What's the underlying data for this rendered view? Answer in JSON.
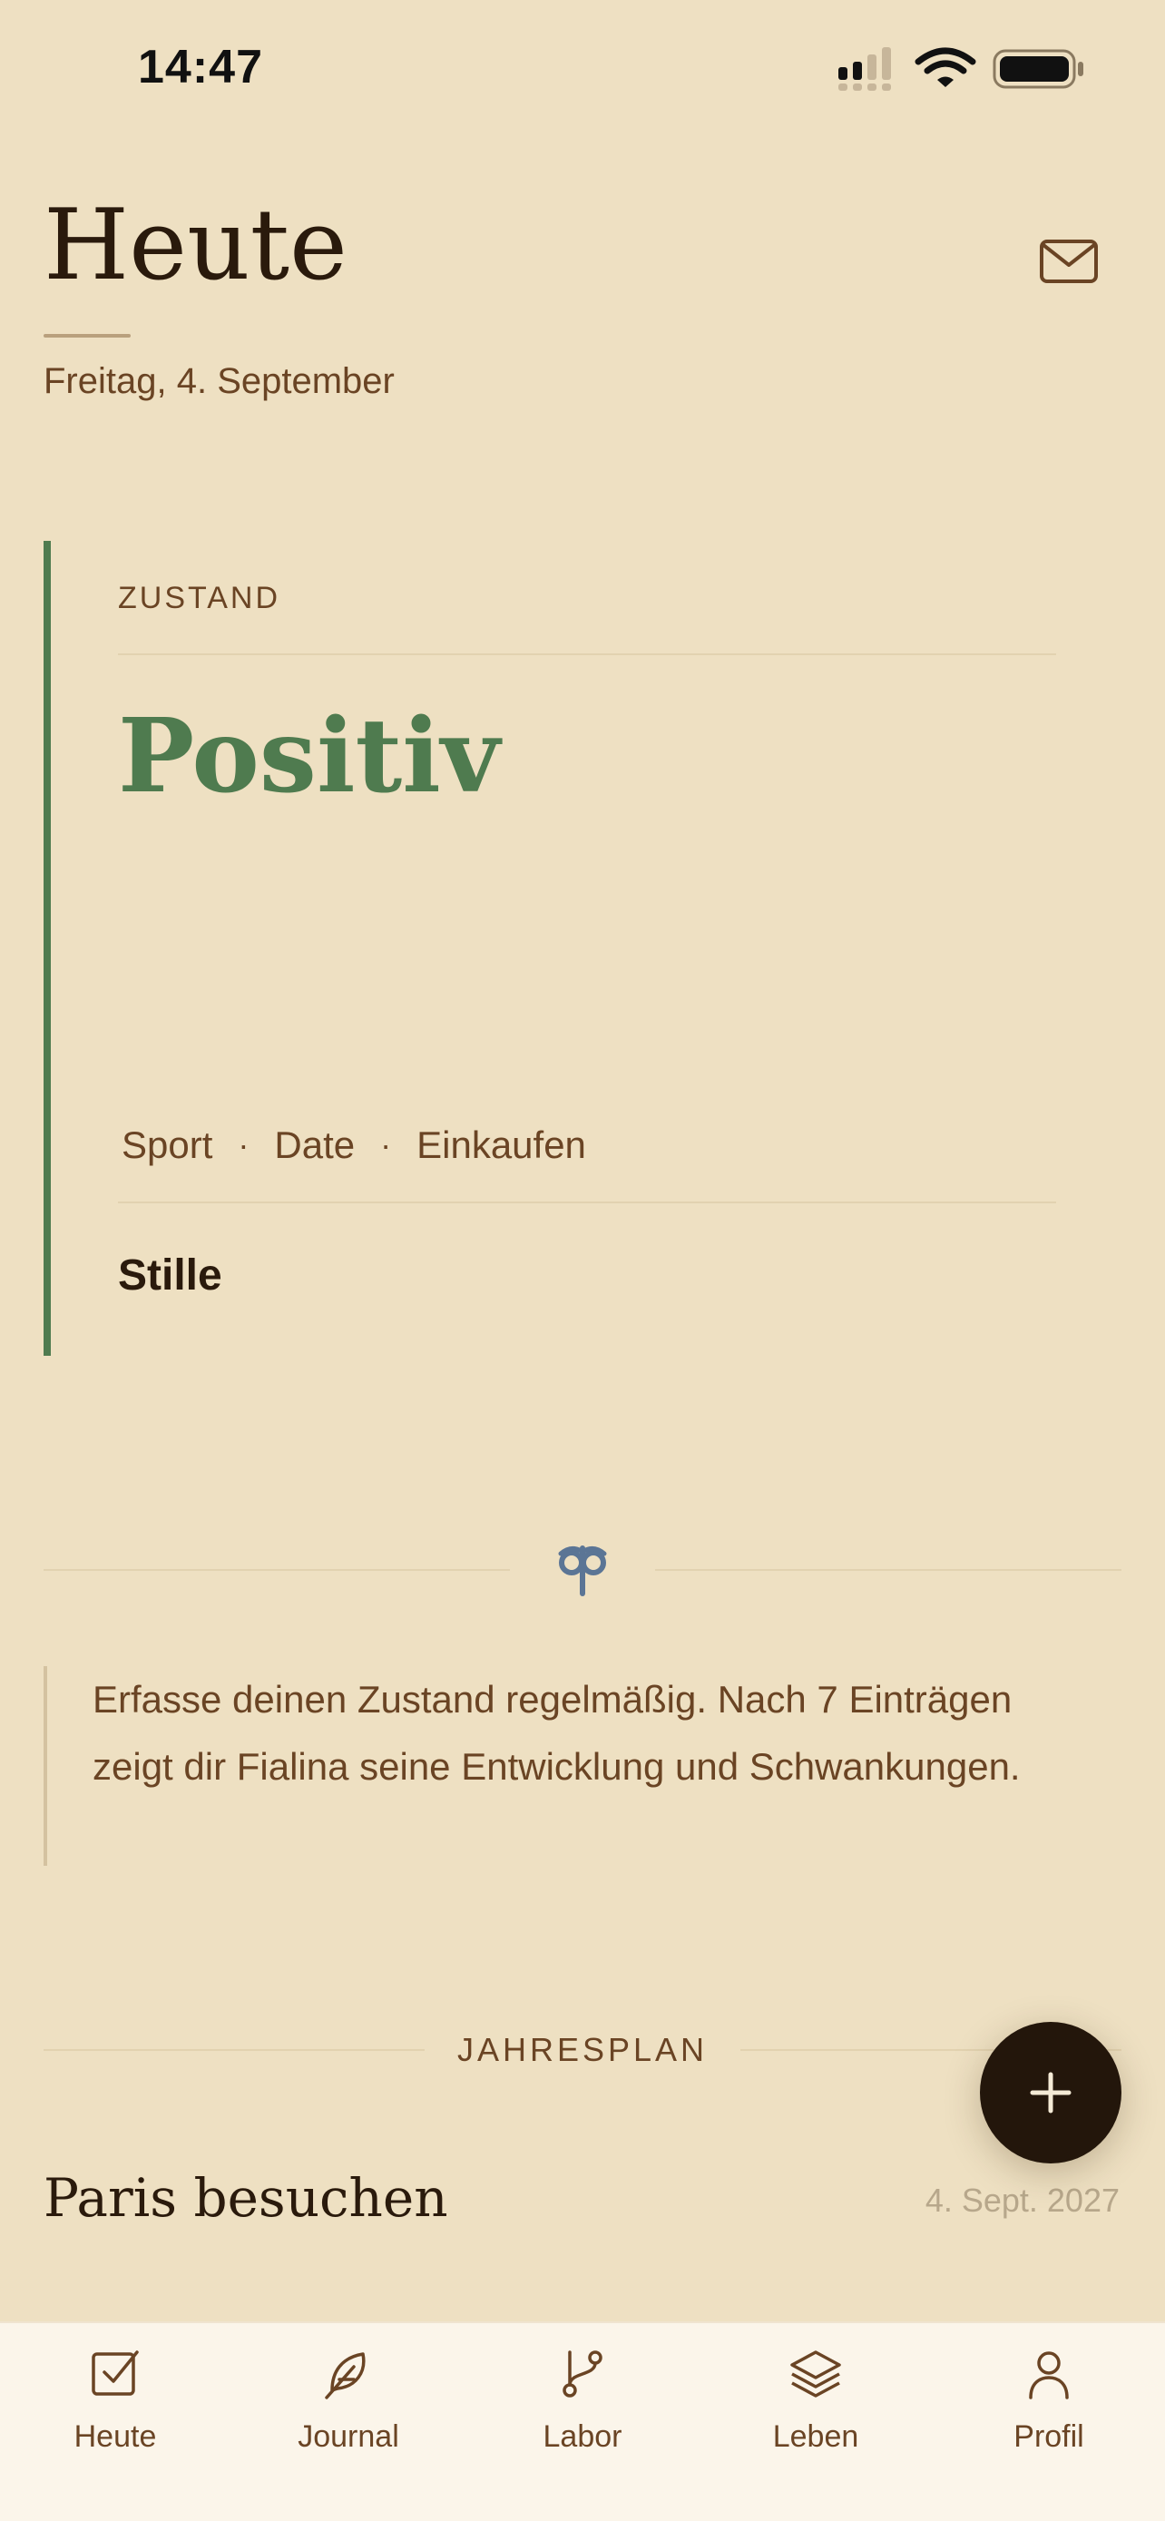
{
  "status_bar": {
    "time": "14:47"
  },
  "header": {
    "title": "Heute",
    "date": "Freitag, 4. September"
  },
  "state_card": {
    "label": "ZUSTAND",
    "state": "Positiv",
    "tags": [
      "Sport",
      "Date",
      "Einkaufen"
    ],
    "separator": "·",
    "note": "Stille",
    "accent_color": "#4F7B4F"
  },
  "hint": {
    "text": "Erfasse deinen Zustand regelmäßig. Nach 7 Einträgen zeigt dir Fialina seine Entwicklung und Schwankungen."
  },
  "yearly_plan": {
    "label": "JAHRESPLAN",
    "items": [
      {
        "title": "Paris besuchen",
        "date": "4. Sept. 2027"
      }
    ]
  },
  "tab_bar": {
    "tabs": [
      {
        "label": "Heute",
        "icon": "checkbox-icon"
      },
      {
        "label": "Journal",
        "icon": "feather-icon"
      },
      {
        "label": "Labor",
        "icon": "branch-icon"
      },
      {
        "label": "Leben",
        "icon": "layers-icon"
      },
      {
        "label": "Profil",
        "icon": "person-icon"
      }
    ]
  },
  "colors": {
    "background": "#EEE0C2",
    "text_brown": "#6A4424",
    "text_dark": "#2A1A0C",
    "positive_green": "#4F7B4F",
    "ornament_blue": "#5B7595",
    "fab": "#23160B"
  }
}
